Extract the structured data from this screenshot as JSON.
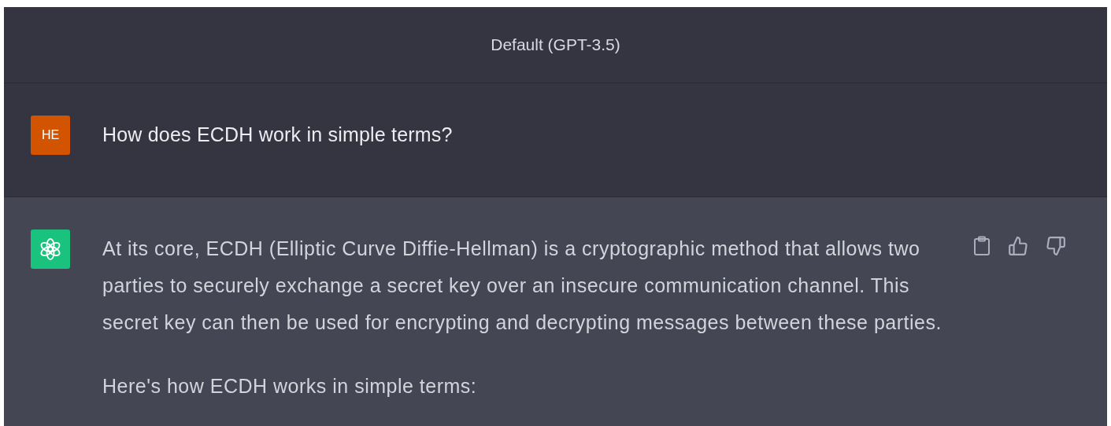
{
  "header": {
    "title": "Default (GPT-3.5)"
  },
  "messages": [
    {
      "kind": "user",
      "avatar": "HE",
      "paragraphs": [
        "How does ECDH work in simple terms?"
      ]
    },
    {
      "kind": "assistant",
      "paragraphs": [
        "At its core, ECDH (Elliptic Curve Diffie-Hellman) is a cryptographic method that allows two parties to securely exchange a secret key over an insecure communication channel. This secret key can then be used for encrypting and decrypting messages between these parties.",
        "Here's how ECDH works in simple terms:"
      ],
      "actions": [
        {
          "kind": "copy"
        },
        {
          "kind": "thumbs_up"
        },
        {
          "kind": "thumbs_down"
        }
      ]
    }
  ]
}
